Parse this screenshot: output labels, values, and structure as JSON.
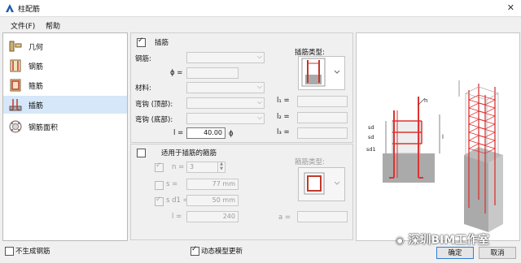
{
  "window": {
    "title": "柱配筋"
  },
  "menu": {
    "file": "文件(F)",
    "help": "帮助"
  },
  "sidebar": {
    "items": [
      {
        "label": "几何"
      },
      {
        "label": "钢筋"
      },
      {
        "label": "箍筋"
      },
      {
        "label": "插筋"
      },
      {
        "label": "钢筋面积"
      }
    ]
  },
  "dowel": {
    "enabled_label": "插筋",
    "rebar_label": "钢筋:",
    "phi_label": "ϕ =",
    "material_label": "材料:",
    "hook_top_label": "弯钩 (顶部):",
    "hook_bottom_label": "弯钩 (底部):",
    "l_label": "l =",
    "l_value": "40.00",
    "l_unit": "ϕ",
    "l1_label": "l₁ =",
    "l2_label": "l₂ =",
    "l3_label": "l₃ =",
    "type_label": "插筋类型:"
  },
  "stirrups": {
    "enabled_label": "适用于插筋的箍筋",
    "n_label": "n =",
    "n_value": "3",
    "s_label": "s =",
    "s_value": "77",
    "s_unit": "mm",
    "s1_label": "s d1 =",
    "s1_value": "50",
    "s1_unit": "mm",
    "l_label": "l =",
    "l_value": "240",
    "a_label": "a =",
    "type_label": "箍筋类型:"
  },
  "footer": {
    "no_rebar_label": "不生成钢筋",
    "dynamic_update_label": "动态模型更新",
    "ok": "确定",
    "cancel": "取消"
  },
  "diagram": {
    "n_label": "n",
    "sd_label": "sd",
    "sd1_label": "sd1",
    "l_label": "l"
  },
  "watermark": "深圳BIM工作室"
}
